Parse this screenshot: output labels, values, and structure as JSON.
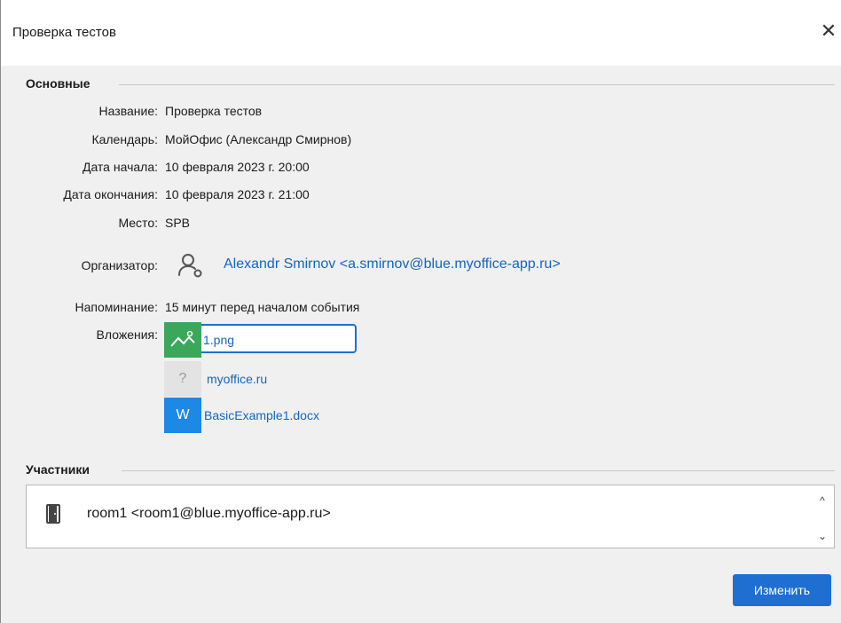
{
  "window": {
    "title": "Проверка тестов",
    "close_glyph": "✕"
  },
  "sections": {
    "main_title": "Основные",
    "participants_title": "Участники"
  },
  "fields": {
    "name_label": "Название:",
    "name_value": "Проверка тестов",
    "calendar_label": "Календарь:",
    "calendar_value": "МойОфис (Александр Смирнов)",
    "start_label": "Дата начала:",
    "start_value": "10 февраля 2023 г. 20:00",
    "end_label": "Дата окончания:",
    "end_value": "10 февраля 2023 г. 21:00",
    "place_label": "Место:",
    "place_value": "SPB",
    "organizer_label": "Организатор:",
    "organizer_value": "Alexandr Smirnov <a.smirnov@blue.myoffice-app.ru>",
    "reminder_label": "Напоминание:",
    "reminder_value": "15 минут перед началом события",
    "attachments_label": "Вложения:"
  },
  "attachments": [
    {
      "name": "1.png",
      "icon": "image-icon",
      "color": "#3aa75b"
    },
    {
      "name": "myoffice.ru",
      "icon": "question-icon",
      "color": "#e3e3e3"
    },
    {
      "name": "BasicExample1.docx",
      "icon": "word-doc-icon",
      "color": "#1e88e5",
      "glyph": "W"
    }
  ],
  "participants": [
    {
      "text": "room1 <room1@blue.myoffice-app.ru>",
      "icon": "door-icon"
    }
  ],
  "scroll": {
    "up_glyph": "^",
    "down_glyph": "⌄"
  },
  "actions": {
    "edit_label": "Изменить"
  },
  "colors": {
    "accent": "#1f6fd2",
    "link": "#1565c0",
    "background": "#f0f0f0"
  }
}
